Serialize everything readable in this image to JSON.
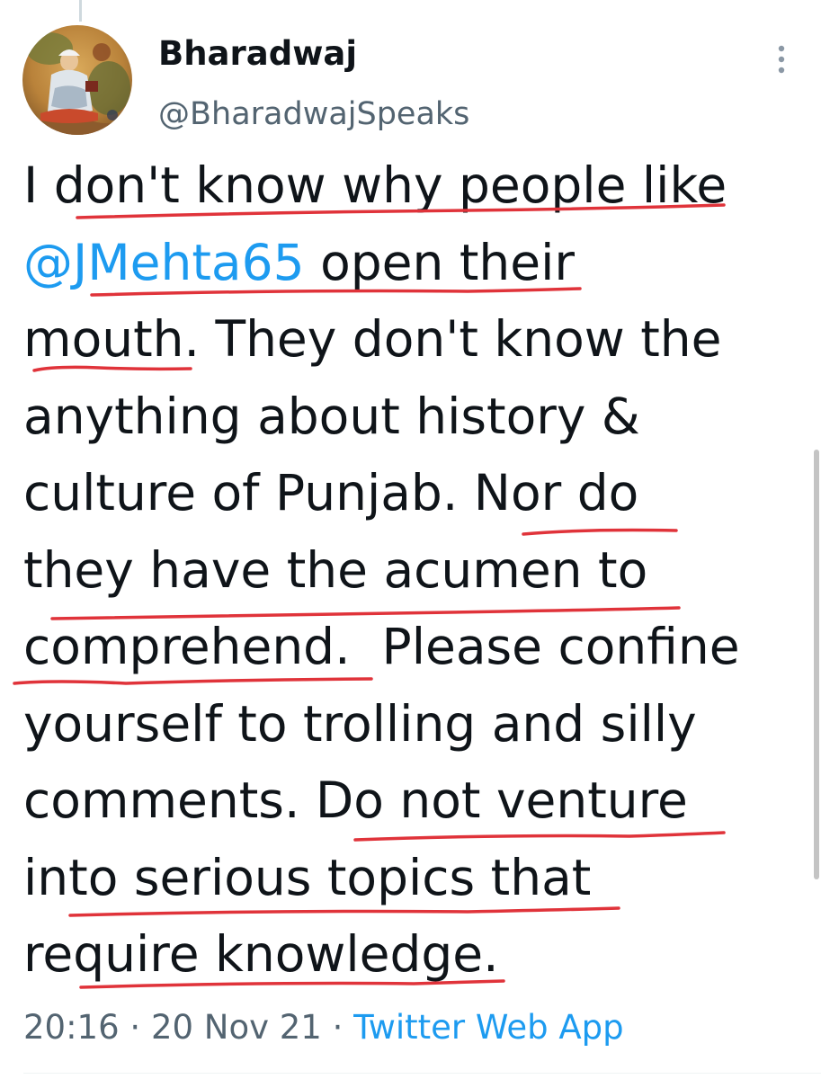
{
  "author": {
    "display_name": "Bharadwaj",
    "handle": "@BharadwajSpeaks"
  },
  "tweet": {
    "lines": [
      [
        {
          "text": "I don't know why people like"
        }
      ],
      [
        {
          "text": "@JMehta65",
          "mention": true
        },
        {
          "text": " open their"
        }
      ],
      [
        {
          "text": "mouth. They don't know the"
        }
      ],
      [
        {
          "text": "anything about history &"
        }
      ],
      [
        {
          "text": "culture of Punjab. Nor do"
        }
      ],
      [
        {
          "text": "they have the acumen to"
        }
      ],
      [
        {
          "text": "comprehend.  Please confine"
        }
      ],
      [
        {
          "text": "yourself to trolling and silly"
        }
      ],
      [
        {
          "text": "comments. Do not venture"
        }
      ],
      [
        {
          "text": "into serious topics that"
        }
      ],
      [
        {
          "text": "require knowledge."
        }
      ]
    ]
  },
  "meta": {
    "time": "20:16",
    "separator": " · ",
    "date": "20 Nov 21",
    "source": "Twitter Web App"
  },
  "icons": {
    "more": "more-vertical-icon",
    "avatar": "profile-avatar"
  },
  "colors": {
    "text": "#0f1419",
    "secondary": "#536471",
    "link": "#1d9bf0",
    "annotation": "#e0333a"
  }
}
